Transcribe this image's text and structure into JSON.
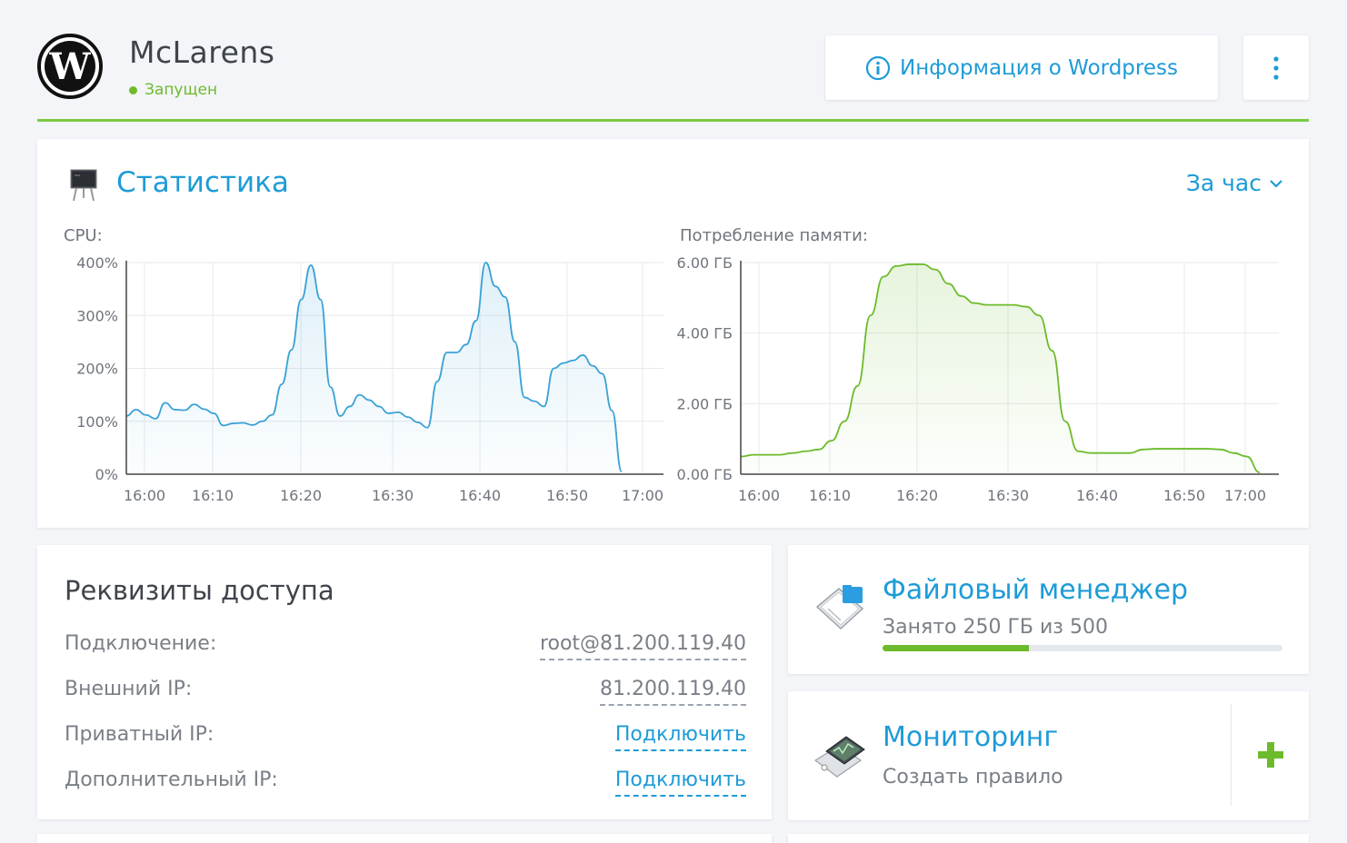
{
  "header": {
    "title": "McLarens",
    "status": "Запущен",
    "info_button": "Информация о Wordpress",
    "accent_color": "#7ac943"
  },
  "stats": {
    "title": "Статистика",
    "period": "За час",
    "cpu_label": "CPU:",
    "mem_label": "Потребление памяти:"
  },
  "chart_data": [
    {
      "type": "area",
      "title": "CPU:",
      "x_ticks": [
        "16:00",
        "16:10",
        "16:20",
        "16:30",
        "16:40",
        "16:50",
        "17:00"
      ],
      "y_ticks": [
        "0%",
        "100%",
        "200%",
        "300%",
        "400%"
      ],
      "ylim": [
        0,
        400
      ],
      "grid": true,
      "color": "#3aa2d6",
      "x": [
        "16:00",
        "16:01",
        "16:02",
        "16:03",
        "16:04",
        "16:05",
        "16:06",
        "16:07",
        "16:08",
        "16:09",
        "16:10",
        "16:11",
        "16:12",
        "16:13",
        "16:14",
        "16:15",
        "16:16",
        "16:17",
        "16:18",
        "16:19",
        "16:20",
        "16:20.5",
        "16:21",
        "16:22",
        "16:23",
        "16:24",
        "16:25",
        "16:26",
        "16:27",
        "16:28",
        "16:29",
        "16:30",
        "16:31",
        "16:32",
        "16:33",
        "16:34",
        "16:35",
        "16:36",
        "16:37",
        "16:38",
        "16:39",
        "16:40",
        "16:41",
        "16:42",
        "16:43",
        "16:44",
        "16:45",
        "16:46",
        "16:47",
        "16:48",
        "16:49",
        "16:50",
        "16:51",
        "16:52",
        "16:53",
        "16:54",
        "16:55",
        "16:56",
        "16:57",
        "16:58",
        "16:59"
      ],
      "values": [
        110,
        122,
        112,
        105,
        135,
        122,
        121,
        132,
        123,
        115,
        92,
        96,
        97,
        93,
        100,
        112,
        170,
        235,
        330,
        395,
        330,
        165,
        110,
        128,
        150,
        140,
        128,
        115,
        117,
        108,
        98,
        88,
        175,
        230,
        230,
        245,
        290,
        400,
        355,
        335,
        250,
        145,
        138,
        128,
        200,
        210,
        215,
        225,
        205,
        190,
        120,
        5
      ]
    },
    {
      "type": "area",
      "title": "Потребление памяти:",
      "x_ticks": [
        "16:00",
        "16:10",
        "16:20",
        "16:30",
        "16:40",
        "16:50",
        "17:00"
      ],
      "y_ticks": [
        "0.00 ГБ",
        "2.00 ГБ",
        "4.00 ГБ",
        "6.00 ГБ"
      ],
      "ylim": [
        0,
        6
      ],
      "grid": true,
      "color": "#6dbb2c",
      "values_gb": [
        0.5,
        0.55,
        0.55,
        0.55,
        0.6,
        0.65,
        0.7,
        0.95,
        1.5,
        2.5,
        4.5,
        5.6,
        5.9,
        5.95,
        5.95,
        5.8,
        5.4,
        5.05,
        4.85,
        4.8,
        4.8,
        4.8,
        4.75,
        4.5,
        3.5,
        1.5,
        0.65,
        0.6,
        0.6,
        0.6,
        0.6,
        0.7,
        0.72,
        0.72,
        0.72,
        0.72,
        0.72,
        0.7,
        0.6,
        0.5,
        0.05
      ]
    }
  ],
  "access": {
    "title": "Реквизиты доступа",
    "rows": [
      {
        "label": "Подключение:",
        "value": "root@81.200.119.40"
      },
      {
        "label": "Внешний IP:",
        "value": "81.200.119.40"
      },
      {
        "label": "Приватный IP:",
        "value": "Подключить"
      },
      {
        "label": "Дополнительный IP:",
        "value": "Подключить"
      }
    ]
  },
  "file_manager": {
    "title": "Файловый менеджер",
    "usage_text": "Занято 250 ГБ из 500",
    "used_gb": 250,
    "total_gb": 500,
    "usage_fraction": 0.365
  },
  "monitoring": {
    "title": "Мониторинг",
    "subtitle": "Создать правило"
  },
  "colors": {
    "link": "#1e9bd7",
    "green": "#6dbb2c"
  }
}
